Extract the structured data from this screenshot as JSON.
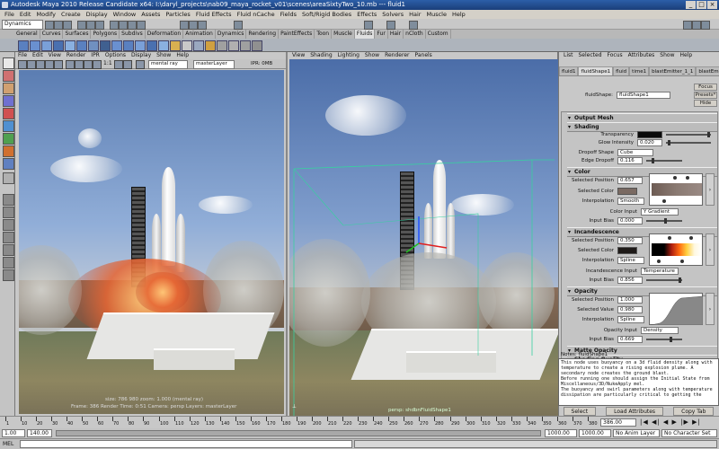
{
  "window": {
    "title": "Autodesk Maya 2010 Release Candidate x64: I:\\daryl_projects\\nab09_maya_rocket_v01\\scenes\\areaSixtyTwo_10.mb --- fluid1",
    "buttons": [
      "_",
      "□",
      "×"
    ]
  },
  "menubar": [
    "File",
    "Edit",
    "Modify",
    "Create",
    "Display",
    "Window",
    "Assets",
    "Particles",
    "Fluid Effects",
    "Fluid nCache",
    "Fields",
    "Soft/Rigid Bodies",
    "Effects",
    "Solvers",
    "Hair",
    "Muscle",
    "Help"
  ],
  "status": {
    "mode": "Dynamics"
  },
  "shelf_tabs": [
    "General",
    "Curves",
    "Surfaces",
    "Polygons",
    "Subdivs",
    "Deformation",
    "Animation",
    "Dynamics",
    "Rendering",
    "PaintEffects",
    "Toon",
    "Muscle",
    "Fluids",
    "Fur",
    "Hair",
    "nCloth",
    "Custom"
  ],
  "shelf_active": "Fluids",
  "render_view": {
    "menu": [
      "File",
      "Edit",
      "View",
      "Render",
      "IPR",
      "Options",
      "Display",
      "Show",
      "Help"
    ],
    "ratio": "1:1",
    "renderer": "mental ray",
    "layer": "masterLayer",
    "ipr_label": "IPR: 0MB",
    "hud_line1": "size: 786  980  zoom: 1.000     (mental ray)",
    "hud_line2": "Frame: 386     Render Time: 0:51     Camera: persp     Layers: masterLayer"
  },
  "persp_view": {
    "menu": [
      "View",
      "Shading",
      "Lighting",
      "Show",
      "Renderer",
      "Panels"
    ],
    "camera_label": "persp: shdbnFluidShape1"
  },
  "attr_editor": {
    "menu": [
      "List",
      "Selected",
      "Focus",
      "Attributes",
      "Show",
      "Help"
    ],
    "tabs": [
      "fluid1",
      "fluidShape1",
      "fluid",
      "time1",
      "blastEmitter_1_1",
      "blastEmitter_1_4"
    ],
    "active_tab": "fluidShape1",
    "shape_label": "fluidShape:",
    "shape_value": "fluidShape1",
    "buttons": [
      "Focus",
      "Presets*",
      "Hide"
    ],
    "sections": {
      "output_mesh": "Output Mesh",
      "shading": "Shading",
      "color": "Color",
      "incandescence": "Incandescence",
      "opacity": "Opacity",
      "matte_opacity": "Matte Opacity",
      "shading_quality": "Shading Quality"
    },
    "shading": {
      "transparency_label": "Transparency",
      "glow_label": "Glow Intensity",
      "glow_value": "0.020",
      "dropoff_label": "Dropoff Shape",
      "dropoff_value": "Cube",
      "edge_label": "Edge Dropoff",
      "edge_value": "0.116"
    },
    "color": {
      "pos_label": "Selected Position",
      "pos_value": "0.657",
      "col_label": "Selected Color",
      "interp_label": "Interpolation",
      "interp_value": "Smooth",
      "input_label": "Color Input",
      "input_value": "Y Gradient",
      "bias_label": "Input Bias",
      "bias_value": "0.000"
    },
    "incandescence": {
      "pos_label": "Selected Position",
      "pos_value": "0.350",
      "col_label": "Selected Color",
      "interp_label": "Interpolation",
      "interp_value": "Spline",
      "input_label": "Incandescence Input",
      "input_value": "Temperature",
      "bias_label": "Input Bias",
      "bias_value": "0.856"
    },
    "opacity": {
      "pos_label": "Selected Position",
      "pos_value": "1.000",
      "val_label": "Selected Value",
      "val_value": "0.980",
      "interp_label": "Interpolation",
      "interp_value": "Spline",
      "input_label": "Opacity Input",
      "input_value": "Density",
      "bias_label": "Input Bias",
      "bias_value": "0.669"
    },
    "notes_label": "Notes:  fluidShape1",
    "notes_text": "This node uses buoyancy on a 3d fluid density along with temperature to create a rising explosion plume. A secondary node creates the ground blast.\nBefore running one should assign the Initial State from Miscellaneous/3D/NukeApply mel.\nThe buoyancy and swirl parameters along with temperature dissipation are particularly critical to getting the",
    "bottom_buttons": [
      "Select",
      "Load Attributes",
      "Copy Tab"
    ]
  },
  "timeline": {
    "ticks": [
      "1",
      "10",
      "20",
      "30",
      "40",
      "50",
      "60",
      "70",
      "80",
      "90",
      "100",
      "110",
      "120",
      "130",
      "140",
      "150",
      "160",
      "170",
      "180",
      "190",
      "200",
      "210",
      "220",
      "230",
      "240",
      "250",
      "260",
      "270",
      "280",
      "290",
      "300",
      "310",
      "320",
      "330",
      "340",
      "350",
      "360",
      "370",
      "380"
    ],
    "current_frame": "386.00",
    "range_start": "1.00",
    "range_inner_start": "1.00",
    "range_inner_end": "1000.00",
    "range_end": "1000.00",
    "anim_layer": "No Anim Layer",
    "char_set": "No Character Set",
    "range_field_value": "140.00"
  },
  "command_line": {
    "label": "MEL"
  }
}
